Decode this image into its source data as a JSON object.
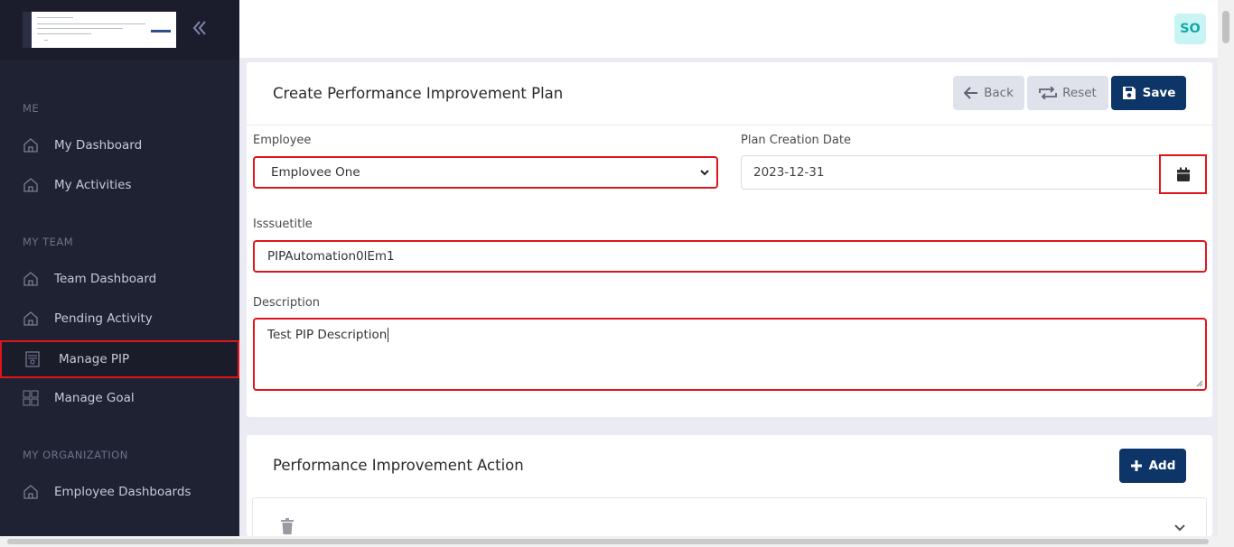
{
  "sidebar": {
    "sections": {
      "me": "ME",
      "my_team": "MY TEAM",
      "my_org": "MY ORGANIZATION"
    },
    "items": [
      {
        "label": "My Dashboard",
        "icon": "home-icon"
      },
      {
        "label": "My Activities",
        "icon": "home-icon"
      },
      {
        "label": "Team Dashboard",
        "icon": "home-icon"
      },
      {
        "label": "Pending Activity",
        "icon": "home-icon"
      },
      {
        "label": "Manage PIP",
        "icon": "document-icon",
        "active": true
      },
      {
        "label": "Manage Goal",
        "icon": "grid-icon"
      },
      {
        "label": "Employee Dashboards",
        "icon": "home-icon"
      }
    ],
    "collapse_icon": "double-chevron-left-icon"
  },
  "header": {
    "avatar_initials": "SO"
  },
  "form": {
    "title": "Create Performance Improvement Plan",
    "buttons": {
      "back": "Back",
      "reset": "Reset",
      "save": "Save"
    },
    "employee": {
      "label": "Employee",
      "value": "Emplovee One"
    },
    "plan_date": {
      "label": "Plan Creation Date",
      "value": "2023-12-31"
    },
    "issue_title": {
      "label": "Isssuetitle",
      "value": "PIPAutomation0lEm1"
    },
    "description": {
      "label": "Description",
      "value": "Test PIP Description"
    }
  },
  "actions": {
    "title": "Performance Improvement Action",
    "add_label": "Add"
  },
  "colors": {
    "sidebar_bg": "#1f2233",
    "primary": "#0d3567",
    "highlight": "#e0151b",
    "avatar_bg": "#c8f5f3",
    "avatar_text": "#17a9a6"
  }
}
